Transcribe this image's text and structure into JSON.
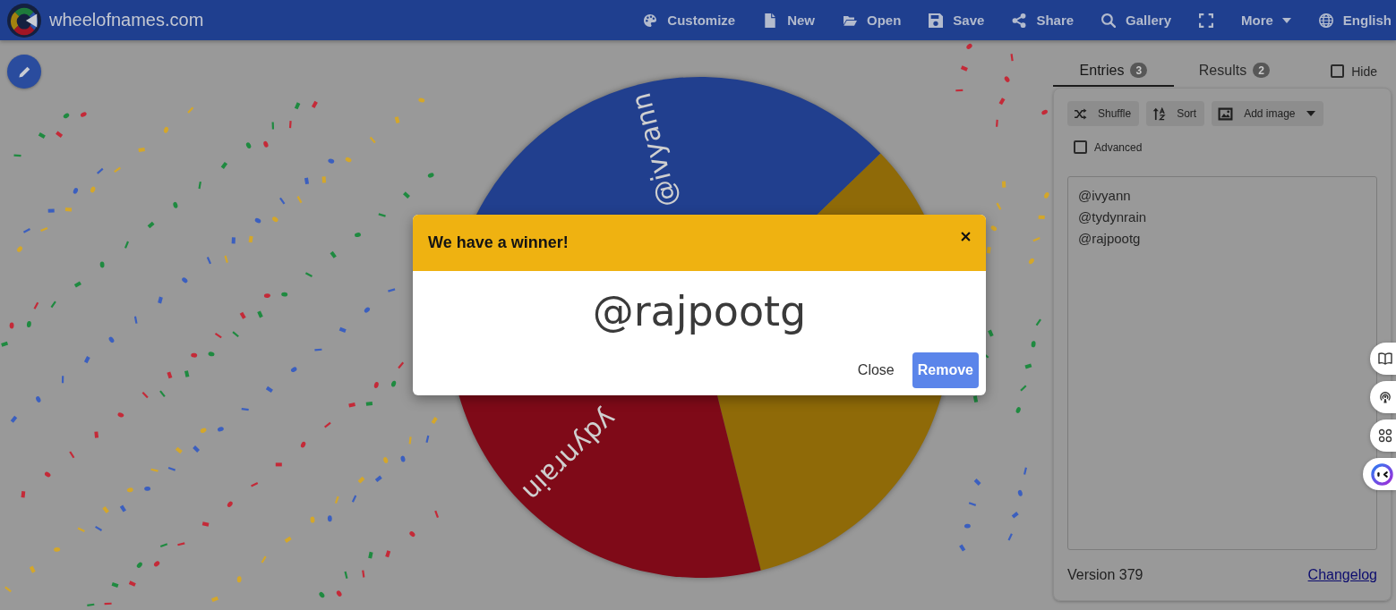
{
  "header": {
    "title": "wheelofnames.com",
    "menu": [
      {
        "kind": "link",
        "label": "Customize"
      },
      {
        "kind": "link",
        "label": "New"
      },
      {
        "kind": "link",
        "label": "Open"
      },
      {
        "kind": "link",
        "label": "Save"
      },
      {
        "kind": "link",
        "label": "Share"
      },
      {
        "kind": "link",
        "label": "Gallery"
      },
      {
        "kind": "icon"
      },
      {
        "kind": "dropdown",
        "label": "More"
      },
      {
        "kind": "link",
        "label": "English"
      }
    ]
  },
  "wheel": {
    "slices": [
      {
        "label": "@ivyann",
        "color": "#213f8e"
      },
      {
        "color": "#8f6a08"
      },
      {
        "label": "ydynrain",
        "color": "#7f0a18"
      }
    ]
  },
  "dialog": {
    "title": "We have a winner!",
    "winner": "@rajpootg",
    "buttons": [
      {
        "kind": "text",
        "label": "Close"
      },
      {
        "kind": "primary",
        "label": "Remove"
      }
    ]
  },
  "sidebar": {
    "tabs": [
      {
        "label": "Entries",
        "count": "3",
        "selected": true
      },
      {
        "label": "Results",
        "count": "2",
        "selected": false
      }
    ],
    "hide": {
      "label": "Hide",
      "checked": false
    },
    "tools": [
      {
        "label": "Shuffle",
        "dropdown": false
      },
      {
        "label": "Sort",
        "dropdown": false
      },
      {
        "label": "Add image",
        "dropdown": true
      }
    ],
    "advanced": {
      "label": "Advanced",
      "checked": false
    },
    "entries": [
      "@ivyann",
      "@tydynrain",
      "@rajpootg"
    ],
    "version": "Version 379",
    "changelog": "Changelog"
  }
}
